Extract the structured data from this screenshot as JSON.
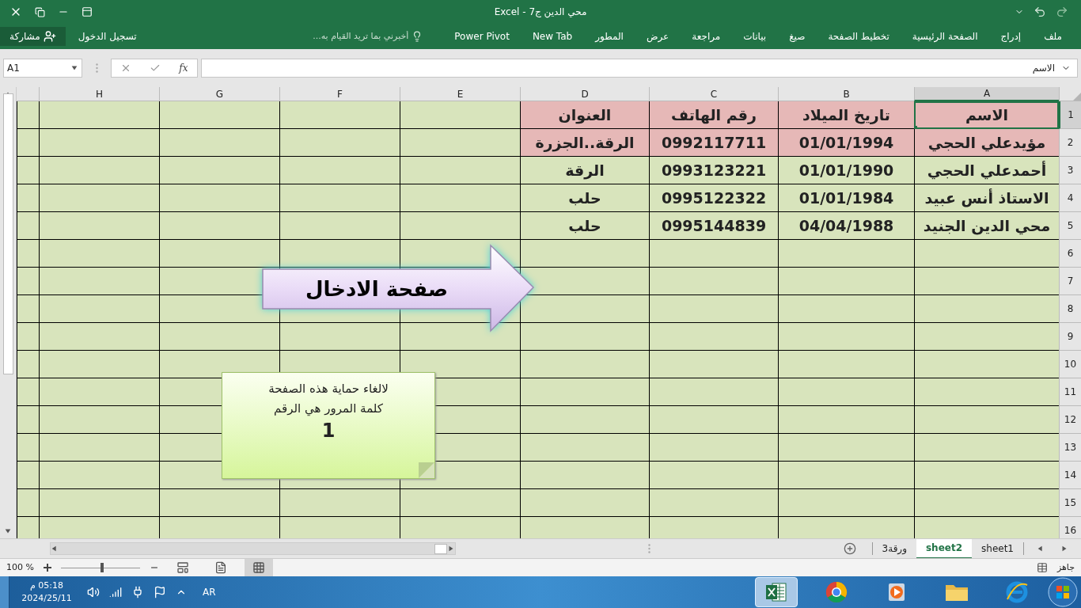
{
  "window": {
    "title": "محي الدين ج7 - Excel"
  },
  "ribbon": {
    "tabs": [
      "ملف",
      "إدراج",
      "الصفحة الرئيسية",
      "تخطيط الصفحة",
      "صيغ",
      "بيانات",
      "مراجعة",
      "عرض",
      "المطور",
      "New Tab",
      "Power Pivot"
    ],
    "tell_me": {
      "placeholder": "أخبرني بما تريد القيام به..."
    },
    "sign_in": "تسجيل الدخول",
    "share": "مشاركة"
  },
  "formula_bar": {
    "name_box": "A1",
    "function_label": "fx",
    "value": "الاسم"
  },
  "sheet": {
    "columns": [
      "A",
      "B",
      "C",
      "D",
      "E",
      "F",
      "G",
      "H"
    ],
    "rows": [
      {
        "number": "1",
        "color": "#e6b8b7",
        "cells": [
          {
            "text": "الاسم",
            "selected": true
          },
          {
            "text": "تاريخ الميلاد",
            "selected": false
          },
          {
            "text": "رقم الهاتف",
            "selected": false
          },
          {
            "text": "العنوان",
            "selected": false
          }
        ]
      },
      {
        "number": "2",
        "color": "#e6b8b7",
        "cells": [
          {
            "text": "مؤيدعلي الحجي",
            "selected": false
          },
          {
            "text": "01/01/1994",
            "selected": false
          },
          {
            "text": "0992117711",
            "selected": false
          },
          {
            "text": "الرقة..الجزرة",
            "selected": false
          }
        ]
      },
      {
        "number": "3",
        "color": "#d8e4bc",
        "cells": [
          {
            "text": "أحمدعلي الحجي",
            "selected": false
          },
          {
            "text": "01/01/1990",
            "selected": false
          },
          {
            "text": "0993123221",
            "selected": false
          },
          {
            "text": "الرقة",
            "selected": false
          }
        ]
      },
      {
        "number": "4",
        "color": "#d8e4bc",
        "cells": [
          {
            "text": "الاستاذ أنس عبيد",
            "selected": false
          },
          {
            "text": "01/01/1984",
            "selected": false
          },
          {
            "text": "0995122322",
            "selected": false
          },
          {
            "text": "حلب",
            "selected": false
          }
        ]
      },
      {
        "number": "5",
        "color": "#d8e4bc",
        "cells": [
          {
            "text": "محي الدين الجنيد",
            "selected": false
          },
          {
            "text": "04/04/1988",
            "selected": false
          },
          {
            "text": "0995144839",
            "selected": false
          },
          {
            "text": "حلب",
            "selected": false
          }
        ]
      },
      {
        "number": "6"
      },
      {
        "number": "7"
      },
      {
        "number": "8"
      },
      {
        "number": "9"
      },
      {
        "number": "10"
      },
      {
        "number": "11"
      },
      {
        "number": "12"
      },
      {
        "number": "13"
      },
      {
        "number": "14"
      },
      {
        "number": "15"
      },
      {
        "number": "16"
      }
    ],
    "arrow_shape": {
      "text": "صفحة الادخال"
    },
    "note": {
      "lines": [
        "لالغاء حماية هذه الصفحة",
        "كلمة المرور هي الرقم"
      ],
      "number": "1"
    }
  },
  "sheet_tabs": [
    {
      "label": "sheet1",
      "selected": false
    },
    {
      "label": "sheet2",
      "selected": true
    },
    {
      "label": "ورقة3",
      "selected": false
    }
  ],
  "status_bar": {
    "status": "جاهز",
    "views": [
      {
        "kind": "normal",
        "selected": true
      },
      {
        "kind": "layout",
        "selected": false
      },
      {
        "kind": "break",
        "selected": false
      }
    ],
    "zoom": {
      "level": 0.5,
      "reading": "100 %"
    }
  },
  "taskbar": {
    "apps": [
      {
        "kind": "ie",
        "active": false
      },
      {
        "kind": "explorer",
        "active": false
      },
      {
        "kind": "media",
        "active": false
      },
      {
        "kind": "chrome",
        "active": false
      },
      {
        "kind": "excel",
        "active": true
      }
    ],
    "language": "AR",
    "time": "05:18 م",
    "date": "2024/25/11"
  }
}
